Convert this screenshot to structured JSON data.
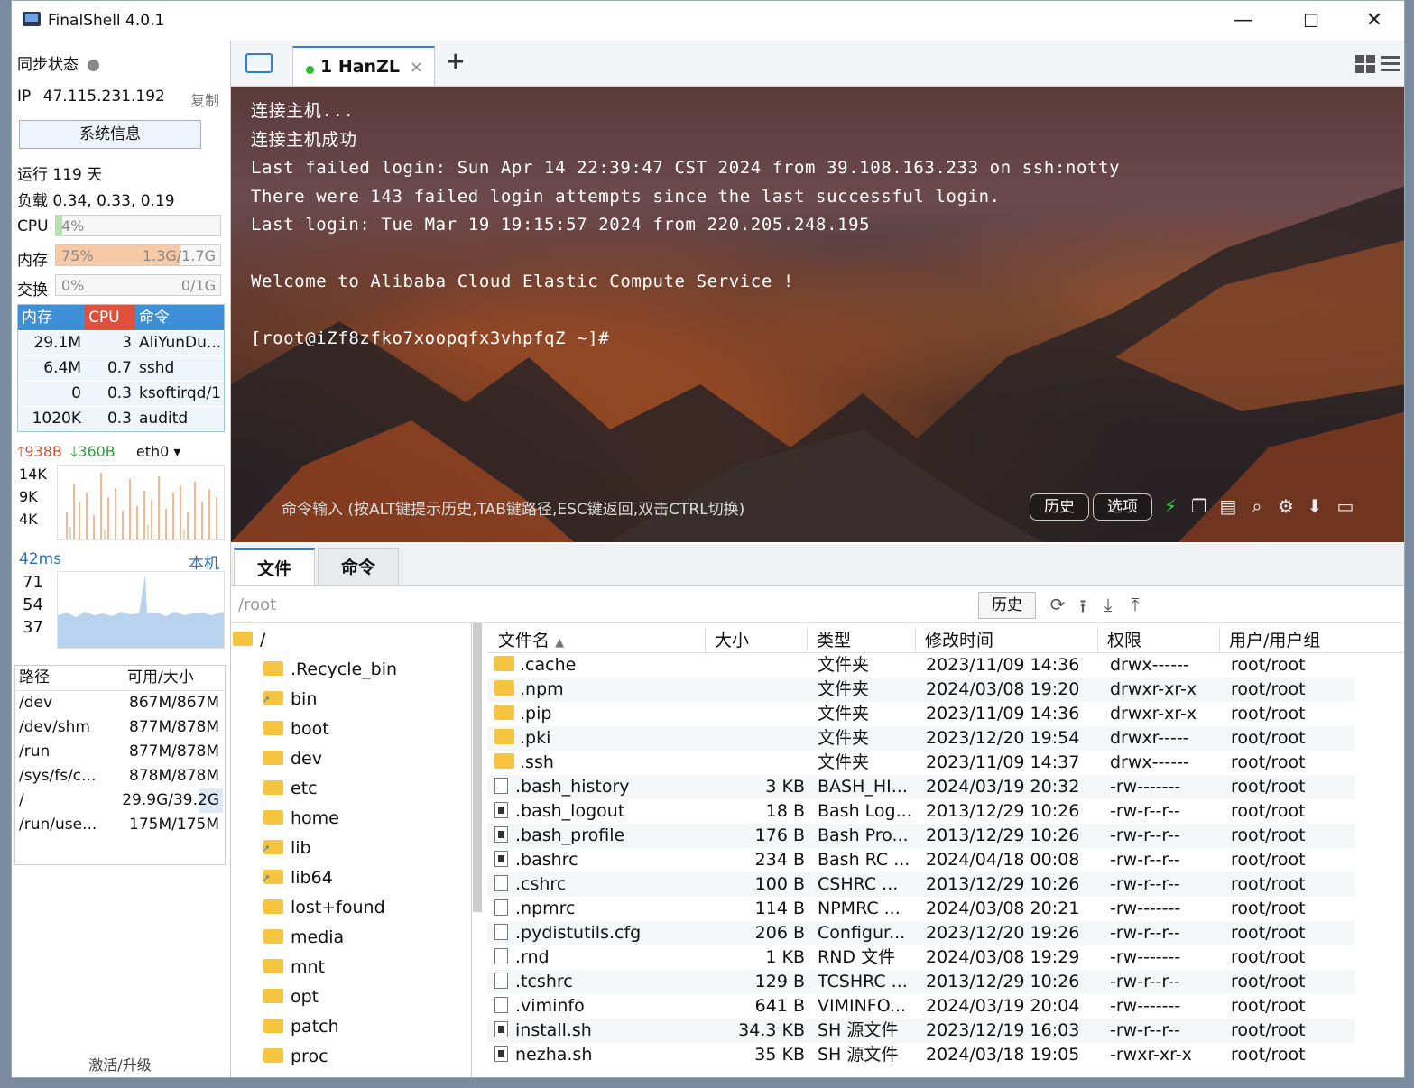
{
  "window": {
    "title": "FinalShell 4.0.1",
    "min": "—",
    "max": "☐",
    "close": "✕"
  },
  "left": {
    "sync_label": "同步状态",
    "ip_label": "IP",
    "ip_value": "47.115.231.192",
    "copy": "复制",
    "sysinfo_button": "系统信息",
    "uptime": "运行 119 天",
    "load": "负载 0.34, 0.33, 0.19",
    "cpu_label": "CPU",
    "cpu_pct": "4%",
    "cpu_fraction": 0.04,
    "mem_label": "内存",
    "mem_pct": "75%",
    "mem_usage": "1.3G/1.7G",
    "mem_fraction": 0.75,
    "swap_label": "交换",
    "swap_pct": "0%",
    "swap_usage": "0/1G",
    "swap_fraction": 0.0,
    "proc_headers": [
      "内存",
      "CPU",
      "命令"
    ],
    "procs": [
      {
        "mem": "29.1M",
        "cpu": "3",
        "cmd": "AliYunDu..."
      },
      {
        "mem": "6.4M",
        "cpu": "0.7",
        "cmd": "sshd"
      },
      {
        "mem": "0",
        "cpu": "0.3",
        "cmd": "ksoftirqd/1"
      },
      {
        "mem": "1020K",
        "cpu": "0.3",
        "cmd": "auditd"
      }
    ],
    "net_up": "938B",
    "net_down": "360B",
    "net_iface": "eth0",
    "net_ticks": [
      "14K",
      "9K",
      "4K"
    ],
    "ping": "42ms",
    "ping_target": "本机",
    "ping_ticks": [
      "71",
      "54",
      "37"
    ],
    "disk_headers": [
      "路径",
      "可用/大小"
    ],
    "disks": [
      {
        "path": "/dev",
        "size": "867M/867M"
      },
      {
        "path": "/dev/shm",
        "size": "877M/878M"
      },
      {
        "path": "/run",
        "size": "877M/878M"
      },
      {
        "path": "/sys/fs/c...",
        "size": "878M/878M"
      },
      {
        "path": "/",
        "size": "29.9G/39.2G"
      },
      {
        "path": "/run/use...",
        "size": "175M/175M"
      }
    ],
    "activate": "激活/升级"
  },
  "tabs": {
    "session_label": "1 HanZL",
    "close": "×",
    "add": "+"
  },
  "terminal": {
    "lines": [
      "连接主机...",
      "连接主机成功",
      "Last failed login: Sun Apr 14 22:39:47 CST 2024 from 39.108.163.233 on ssh:notty",
      "There were 143 failed login attempts since the last successful login.",
      "Last login: Tue Mar 19 19:15:57 2024 from 220.205.248.195",
      "",
      "Welcome to Alibaba Cloud Elastic Compute Service !",
      "",
      "[root@iZf8zfko7xoopqfx3vhpfqZ ~]#"
    ],
    "cmd_hint": "命令输入 (按ALT键提示历史,TAB键路径,ESC键返回,双击CTRL切换)",
    "history_btn": "历史",
    "options_btn": "选项"
  },
  "files": {
    "tab_files": "文件",
    "tab_cmd": "命令",
    "path": "/root",
    "history_btn": "历史",
    "tree_root": "/",
    "tree": [
      {
        "name": ".Recycle_bin",
        "link": false
      },
      {
        "name": "bin",
        "link": true
      },
      {
        "name": "boot",
        "link": false
      },
      {
        "name": "dev",
        "link": false
      },
      {
        "name": "etc",
        "link": false
      },
      {
        "name": "home",
        "link": false
      },
      {
        "name": "lib",
        "link": true
      },
      {
        "name": "lib64",
        "link": true
      },
      {
        "name": "lost+found",
        "link": false
      },
      {
        "name": "media",
        "link": false
      },
      {
        "name": "mnt",
        "link": false
      },
      {
        "name": "opt",
        "link": false
      },
      {
        "name": "patch",
        "link": false
      },
      {
        "name": "proc",
        "link": false
      }
    ],
    "headers": [
      "文件名",
      "大小",
      "类型",
      "修改时间",
      "权限",
      "用户/用户组"
    ],
    "rows": [
      {
        "name": ".cache",
        "size": "",
        "type": "文件夹",
        "mtime": "2023/11/09 14:36",
        "perm": "drwx------",
        "owner": "root/root",
        "kind": "folder"
      },
      {
        "name": ".npm",
        "size": "",
        "type": "文件夹",
        "mtime": "2024/03/08 19:20",
        "perm": "drwxr-xr-x",
        "owner": "root/root",
        "kind": "folder"
      },
      {
        "name": ".pip",
        "size": "",
        "type": "文件夹",
        "mtime": "2023/11/09 14:36",
        "perm": "drwxr-xr-x",
        "owner": "root/root",
        "kind": "folder"
      },
      {
        "name": ".pki",
        "size": "",
        "type": "文件夹",
        "mtime": "2023/12/20 19:54",
        "perm": "drwxr-----",
        "owner": "root/root",
        "kind": "folder"
      },
      {
        "name": ".ssh",
        "size": "",
        "type": "文件夹",
        "mtime": "2023/11/09 14:37",
        "perm": "drwx------",
        "owner": "root/root",
        "kind": "folder"
      },
      {
        "name": ".bash_history",
        "size": "3 KB",
        "type": "BASH_HI...",
        "mtime": "2024/03/19 20:32",
        "perm": "-rw-------",
        "owner": "root/root",
        "kind": "file"
      },
      {
        "name": ".bash_logout",
        "size": "18 B",
        "type": "Bash Log...",
        "mtime": "2013/12/29 10:26",
        "perm": "-rw-r--r--",
        "owner": "root/root",
        "kind": "sh"
      },
      {
        "name": ".bash_profile",
        "size": "176 B",
        "type": "Bash Pro...",
        "mtime": "2013/12/29 10:26",
        "perm": "-rw-r--r--",
        "owner": "root/root",
        "kind": "sh"
      },
      {
        "name": ".bashrc",
        "size": "234 B",
        "type": "Bash RC ...",
        "mtime": "2024/04/18 00:08",
        "perm": "-rw-r--r--",
        "owner": "root/root",
        "kind": "sh"
      },
      {
        "name": ".cshrc",
        "size": "100 B",
        "type": "CSHRC ...",
        "mtime": "2013/12/29 10:26",
        "perm": "-rw-r--r--",
        "owner": "root/root",
        "kind": "file"
      },
      {
        "name": ".npmrc",
        "size": "114 B",
        "type": "NPMRC ...",
        "mtime": "2024/03/08 20:21",
        "perm": "-rw-------",
        "owner": "root/root",
        "kind": "file"
      },
      {
        "name": ".pydistutils.cfg",
        "size": "206 B",
        "type": "Configur...",
        "mtime": "2023/12/20 19:26",
        "perm": "-rw-r--r--",
        "owner": "root/root",
        "kind": "file"
      },
      {
        "name": ".rnd",
        "size": "1 KB",
        "type": "RND 文件",
        "mtime": "2024/03/08 19:29",
        "perm": "-rw-------",
        "owner": "root/root",
        "kind": "file"
      },
      {
        "name": ".tcshrc",
        "size": "129 B",
        "type": "TCSHRC ...",
        "mtime": "2013/12/29 10:26",
        "perm": "-rw-r--r--",
        "owner": "root/root",
        "kind": "file"
      },
      {
        "name": ".viminfo",
        "size": "641 B",
        "type": "VIMINFO...",
        "mtime": "2024/03/19 20:04",
        "perm": "-rw-------",
        "owner": "root/root",
        "kind": "file"
      },
      {
        "name": "install.sh",
        "size": "34.3 KB",
        "type": "SH 源文件",
        "mtime": "2023/12/19 16:03",
        "perm": "-rw-r--r--",
        "owner": "root/root",
        "kind": "sh"
      },
      {
        "name": "nezha.sh",
        "size": "35 KB",
        "type": "SH 源文件",
        "mtime": "2024/03/18 19:05",
        "perm": "-rwxr-xr-x",
        "owner": "root/root",
        "kind": "sh"
      }
    ]
  },
  "colors": {
    "accent": "#2f7fd0",
    "status_green": "#2eb82e",
    "mem_fill": "#f7c9a4",
    "cpu_fill": "#b9e0b0",
    "proc_header": "#3d8fd6"
  }
}
